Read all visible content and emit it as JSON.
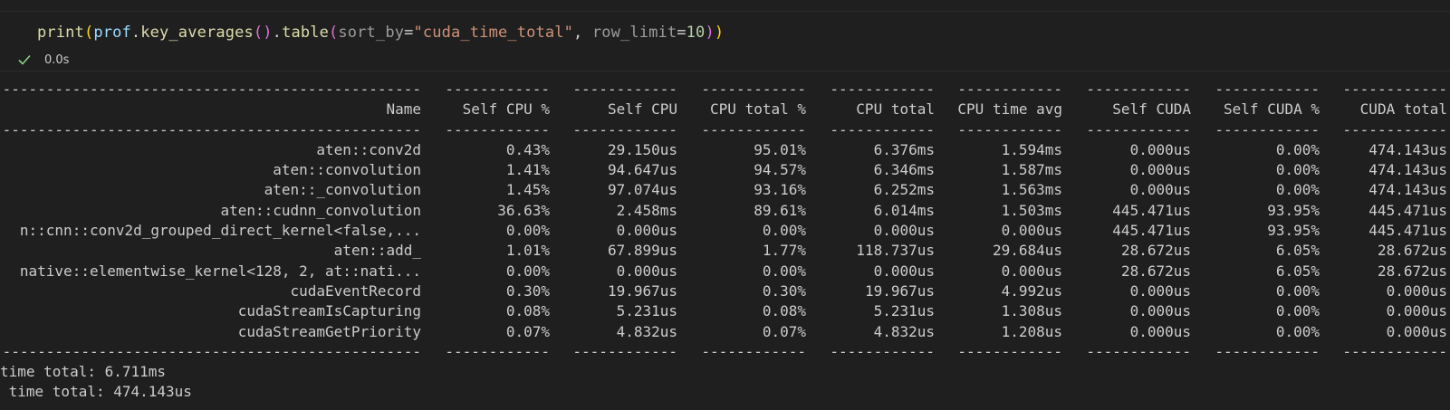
{
  "code": {
    "fn": "print",
    "obj": "prof",
    "method1": "key_averages",
    "method2": "table",
    "param1": "sort_by",
    "value1": "\"cuda_time_total\"",
    "param2": "row_limit",
    "value2": "10",
    "eq": "=",
    "dot": ".",
    "comma": ", ",
    "open": "(",
    "close": ")"
  },
  "exec": {
    "status_icon": "check-icon",
    "time": "0.0s"
  },
  "table": {
    "dash_name": "---------------------------------------------------",
    "dash_col": "------------",
    "headers": [
      "Name",
      "Self CPU %",
      "Self CPU",
      "CPU total %",
      "CPU total",
      "CPU time avg",
      "Self CUDA",
      "Self CUDA %",
      "CUDA total"
    ],
    "rows": [
      [
        "aten::conv2d",
        "0.43%",
        "29.150us",
        "95.01%",
        "6.376ms",
        "1.594ms",
        "0.000us",
        "0.00%",
        "474.143us"
      ],
      [
        "aten::convolution",
        "1.41%",
        "94.647us",
        "94.57%",
        "6.346ms",
        "1.587ms",
        "0.000us",
        "0.00%",
        "474.143us"
      ],
      [
        "aten::_convolution",
        "1.45%",
        "97.074us",
        "93.16%",
        "6.252ms",
        "1.563ms",
        "0.000us",
        "0.00%",
        "474.143us"
      ],
      [
        "aten::cudnn_convolution",
        "36.63%",
        "2.458ms",
        "89.61%",
        "6.014ms",
        "1.503ms",
        "445.471us",
        "93.95%",
        "445.471us"
      ],
      [
        "n::cnn::conv2d_grouped_direct_kernel<false,...",
        "0.00%",
        "0.000us",
        "0.00%",
        "0.000us",
        "0.000us",
        "445.471us",
        "93.95%",
        "445.471us"
      ],
      [
        "aten::add_",
        "1.01%",
        "67.899us",
        "1.77%",
        "118.737us",
        "29.684us",
        "28.672us",
        "6.05%",
        "28.672us"
      ],
      [
        "native::elementwise_kernel<128, 2, at::nati...",
        "0.00%",
        "0.000us",
        "0.00%",
        "0.000us",
        "0.000us",
        "28.672us",
        "6.05%",
        "28.672us"
      ],
      [
        "cudaEventRecord",
        "0.30%",
        "19.967us",
        "0.30%",
        "19.967us",
        "4.992us",
        "0.000us",
        "0.00%",
        "0.000us"
      ],
      [
        "cudaStreamIsCapturing",
        "0.08%",
        "5.231us",
        "0.08%",
        "5.231us",
        "1.308us",
        "0.000us",
        "0.00%",
        "0.000us"
      ],
      [
        "cudaStreamGetPriority",
        "0.07%",
        "4.832us",
        "0.07%",
        "4.832us",
        "1.208us",
        "0.000us",
        "0.00%",
        "0.000us"
      ]
    ],
    "summary": [
      "time total: 6.711ms",
      " time total: 474.143us"
    ]
  }
}
